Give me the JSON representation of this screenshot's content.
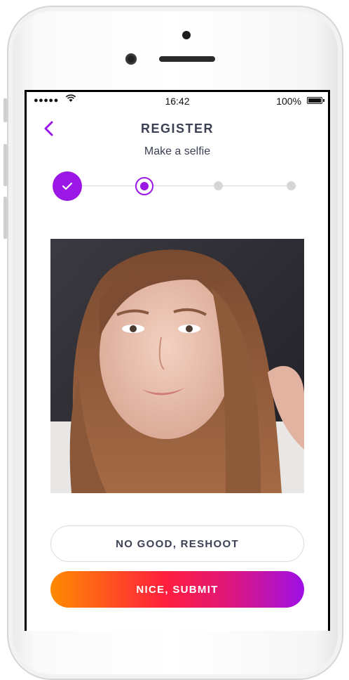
{
  "status_bar": {
    "signal": "●●●●●",
    "time": "16:42",
    "battery": "100%"
  },
  "header": {
    "title": "REGISTER",
    "subtitle": "Make a selfie"
  },
  "stepper": {
    "steps": [
      "done",
      "active",
      "pending",
      "pending"
    ],
    "accent_color": "#9b17e6",
    "inactive_color": "#d6d6d6"
  },
  "photo": {
    "description_icon": "selfie-photo"
  },
  "actions": {
    "reshoot_label": "NO GOOD, RESHOOT",
    "submit_label": "NICE, SUBMIT",
    "submit_gradient": [
      "#ff8a00",
      "#ff1f3d",
      "#9e10e6"
    ]
  }
}
